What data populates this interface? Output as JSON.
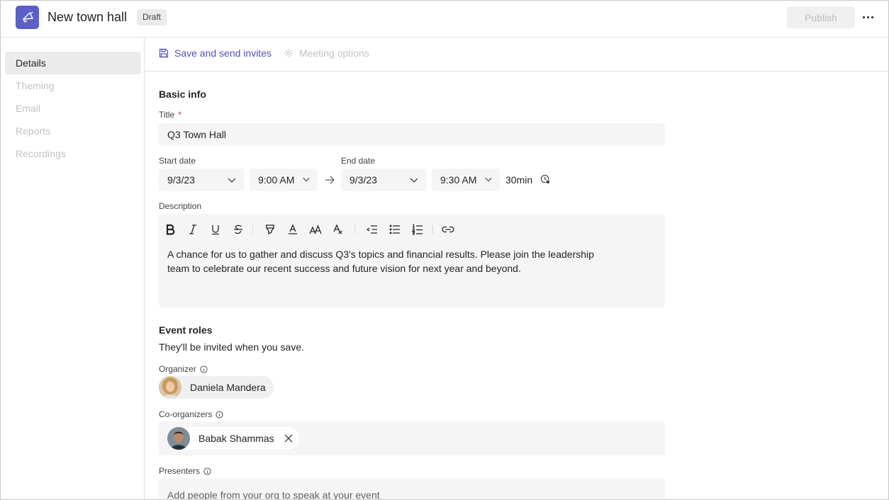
{
  "header": {
    "app_icon": "megaphone-icon",
    "title": "New town hall",
    "badge": "Draft",
    "publish_label": "Publish",
    "more_icon": "more-horizontal-icon"
  },
  "sidebar": {
    "items": [
      {
        "label": "Details",
        "active": true
      },
      {
        "label": "Theming",
        "active": false
      },
      {
        "label": "Email",
        "active": false
      },
      {
        "label": "Reports",
        "active": false
      },
      {
        "label": "Recordings",
        "active": false
      }
    ]
  },
  "toolbar": {
    "save_label": "Save and send invites",
    "save_icon": "save-icon",
    "options_label": "Meeting options",
    "options_icon": "gear-icon"
  },
  "basic_info": {
    "heading": "Basic info",
    "title_label": "Title",
    "required_mark": "*",
    "title_value": "Q3 Town Hall",
    "start_label": "Start date",
    "start_date": "9/3/23",
    "start_time": "9:00 AM",
    "end_label": "End date",
    "end_date": "9/3/23",
    "end_time": "9:30 AM",
    "duration": "30min",
    "description_label": "Description",
    "description_line1": "A chance for us to gather and discuss Q3's topics and financial results. Please join the leadership",
    "description_line2": "team to celebrate our recent success and future vision for next year and beyond."
  },
  "format_icons": [
    "bold-icon",
    "italic-icon",
    "underline-icon",
    "strikethrough-icon",
    "highlight-icon",
    "font-color-icon",
    "font-size-icon",
    "clear-format-icon",
    "outdent-icon",
    "bulleted-list-icon",
    "numbered-list-icon",
    "link-icon"
  ],
  "event_roles": {
    "heading": "Event roles",
    "subtext": "They'll be invited when you save.",
    "organizer_label": "Organizer",
    "organizer_name": "Daniela Mandera",
    "coorganizers_label": "Co-organizers",
    "coorganizer_name": "Babak Shammas",
    "presenters_label": "Presenters",
    "presenters_placeholder": "Add people from your org to speak at your event"
  },
  "colors": {
    "brand": "#5b5fc7",
    "link": "#4f52b2",
    "required": "#c4314b"
  }
}
